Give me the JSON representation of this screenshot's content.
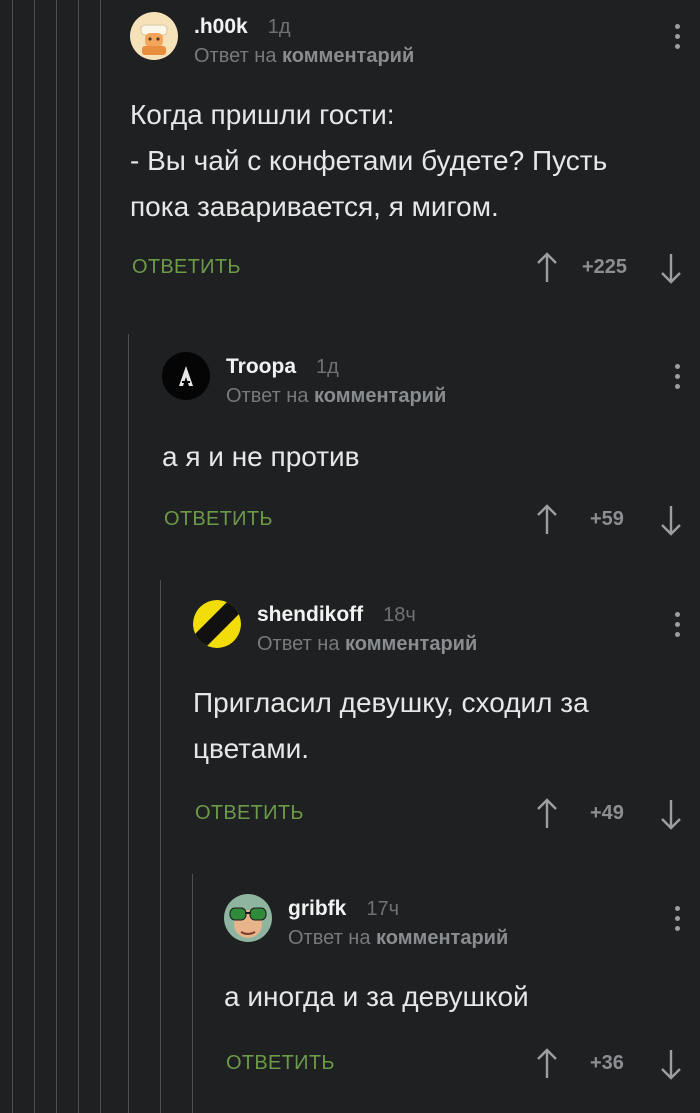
{
  "comments": [
    {
      "author": ".h00k",
      "time": "1д",
      "reply_prefix": "Ответ на",
      "reply_target": "комментарий",
      "text_lines": [
        "Когда пришли гости:",
        "- Вы чай с конфетами будете? Пусть",
        "пока заваривается, я мигом."
      ],
      "reply_label": "ОТВЕТИТЬ",
      "score": "+225"
    },
    {
      "author": "Troopa",
      "time": "1д",
      "reply_prefix": "Ответ на",
      "reply_target": "комментарий",
      "text_lines": [
        "а я и не против"
      ],
      "reply_label": "ОТВЕТИТЬ",
      "score": "+59"
    },
    {
      "author": "shendikoff",
      "time": "18ч",
      "reply_prefix": "Ответ на",
      "reply_target": "комментарий",
      "text_lines": [
        "Пригласил девушку, сходил за",
        "цветами."
      ],
      "reply_label": "ОТВЕТИТЬ",
      "score": "+49"
    },
    {
      "author": "gribfk",
      "time": "17ч",
      "reply_prefix": "Ответ на",
      "reply_target": "комментарий",
      "text_lines": [
        "а иногда и за девушкой"
      ],
      "reply_label": "ОТВЕТИТЬ",
      "score": "+36"
    }
  ],
  "colors": {
    "background": "#1e2022",
    "reply_button": "#6c9a48",
    "thread_line": "#4d5053"
  }
}
